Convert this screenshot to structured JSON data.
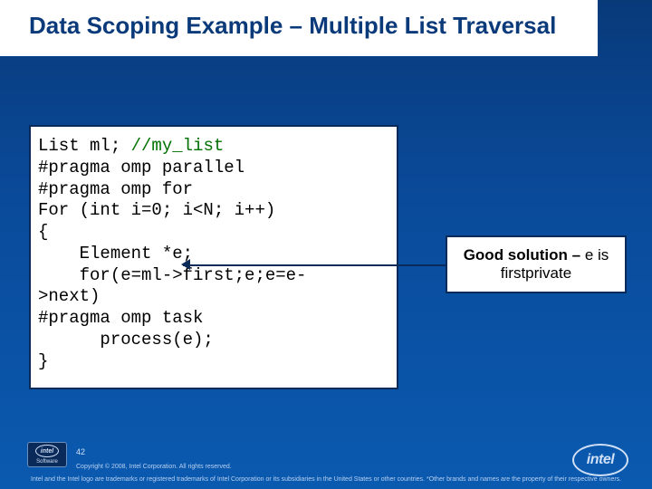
{
  "title": "Data Scoping Example – Multiple List Traversal",
  "code": {
    "line1_a": "List ml; ",
    "line1_b": "//my_list",
    "line2": "#pragma omp parallel",
    "line3": "#pragma omp for",
    "line4": "For (int i=0; i<N; i++)",
    "line5": "{",
    "line6": "    Element *e;",
    "line7": "    for(e=ml->first;e;e=e-",
    "line8": ">next)",
    "line9": "#pragma omp task",
    "line10": "      process(e);",
    "line11": "}"
  },
  "callout": {
    "bold": "Good solution –",
    "rest": " e is firstprivate"
  },
  "footer": {
    "page": "42",
    "copyright": "Copyright © 2008, Intel Corporation. All rights reserved.",
    "legal": "Intel and the Intel logo are trademarks or registered trademarks of Intel Corporation or its subsidiaries in the United States or other countries. *Other brands and names are the property of their respective owners.",
    "logo_text": "intel",
    "badge_text": "Software"
  }
}
